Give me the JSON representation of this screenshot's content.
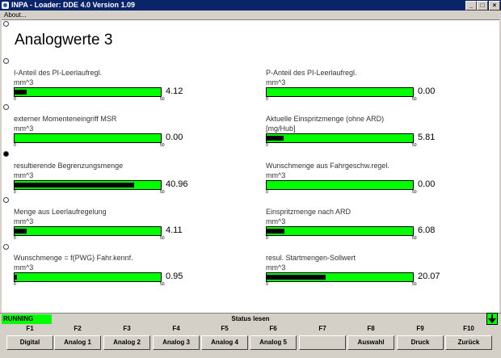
{
  "window": {
    "title": "INPA - Loader:  DDE 4.0 Version 1.09",
    "minimize": "_",
    "maximize": "□",
    "close": "×"
  },
  "menu": {
    "about": "About..."
  },
  "page": {
    "title": "Analogwerte 3"
  },
  "channels": [
    {
      "name": "I-Anteil des PI-Leerlaufregl.",
      "unit": "mm^3",
      "min": "0",
      "max": "50",
      "value": "4.12",
      "fraction": 0.0824
    },
    {
      "name": "P-Anteil des PI-Leerlaufregl.",
      "unit": "mm^3",
      "min": "0",
      "max": "50",
      "value": "0.00",
      "fraction": 0
    },
    {
      "name": "externer Momenteneingriff MSR",
      "unit": "mm^3",
      "min": "0",
      "max": "50",
      "value": "0.00",
      "fraction": 0
    },
    {
      "name": "Aktuelle Einspritzmenge (ohne ARD)",
      "unit": "[mg/Hub]",
      "min": "0",
      "max": "50",
      "value": "5.81",
      "fraction": 0.1162
    },
    {
      "name": "resultierende Begrenzungsmenge",
      "unit": "mm^3",
      "min": "0",
      "max": "50",
      "value": "40.96",
      "fraction": 0.8192
    },
    {
      "name": "Wunschmenge aus Fahrgeschw.regel.",
      "unit": "mm^3",
      "min": "0",
      "max": "50",
      "value": "0.00",
      "fraction": 0
    },
    {
      "name": "Menge aus Leerlaufregelung",
      "unit": "mm^3",
      "min": "0",
      "max": "50",
      "value": "4.11",
      "fraction": 0.0822
    },
    {
      "name": "Einspritzmenge nach ARD",
      "unit": "mm^3",
      "min": "0",
      "max": "50",
      "value": "6.08",
      "fraction": 0.1216
    },
    {
      "name": "Wunschmenge = f(PWG) Fahr.kennf.",
      "unit": "mm^3",
      "min": "0",
      "max": "50",
      "value": "0.95",
      "fraction": 0.019
    },
    {
      "name": "resul. Startmengen-Sollwert",
      "unit": "mm^3",
      "min": "0",
      "max": "50",
      "value": "20.07",
      "fraction": 0.4014
    }
  ],
  "selectors": [
    {
      "selected": false
    },
    {
      "selected": false
    },
    {
      "selected": false
    },
    {
      "selected": true
    },
    {
      "selected": false
    },
    {
      "selected": false
    }
  ],
  "status": {
    "state": "RUNNING",
    "text": "Status lesen"
  },
  "fkeys": [
    {
      "key": "F1",
      "label": "Digital"
    },
    {
      "key": "F2",
      "label": "Analog 1"
    },
    {
      "key": "F3",
      "label": "Analog 2"
    },
    {
      "key": "F4",
      "label": "Analog 3"
    },
    {
      "key": "F5",
      "label": "Analog 4"
    },
    {
      "key": "F6",
      "label": "Analog 5"
    },
    {
      "key": "F7",
      "label": ""
    },
    {
      "key": "F8",
      "label": "Auswahl"
    },
    {
      "key": "F9",
      "label": "Druck"
    },
    {
      "key": "F10",
      "label": "Zurück"
    }
  ],
  "colors": {
    "bar": "#00ff00",
    "fill": "#000000",
    "titlebar": "#0a246a",
    "running": "#00ff00"
  }
}
